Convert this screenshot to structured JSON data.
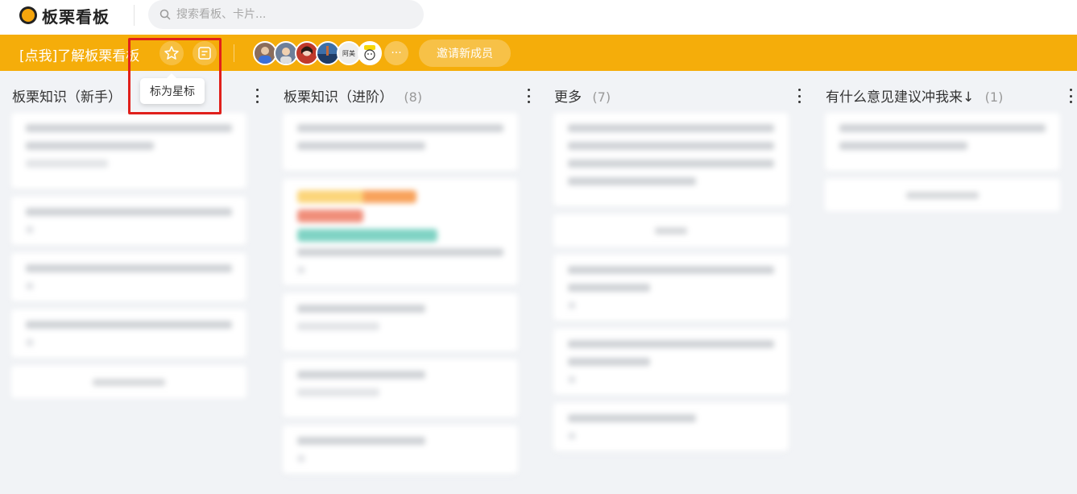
{
  "app": {
    "name": "板栗看板",
    "search_placeholder": "搜索看板、卡片..."
  },
  "board": {
    "title": "[点我]了解板栗看板",
    "star_tooltip": "标为星标",
    "invite_label": "邀请新成员",
    "more_members": "···",
    "members": [
      {
        "name": "member-1",
        "color": "#8b6d5c"
      },
      {
        "name": "member-2",
        "color": "#6d7f9a"
      },
      {
        "name": "member-3",
        "color": "#c0392b"
      },
      {
        "name": "member-4",
        "color": "#3d6fa8"
      },
      {
        "name": "member-5",
        "label": "阿美",
        "color": "#eeeeee"
      },
      {
        "name": "member-6",
        "color": "#ffffff"
      }
    ]
  },
  "lists": [
    {
      "title": "板栗知识（新手）",
      "count": ""
    },
    {
      "title": "板栗知识（进阶）",
      "count": "(8)"
    },
    {
      "title": "更多",
      "count": "(7)"
    },
    {
      "title": "有什么意见建议冲我来↓",
      "count": "(1)"
    }
  ],
  "colors": {
    "brand": "#f5ad0a",
    "highlight": "#e0201b"
  }
}
